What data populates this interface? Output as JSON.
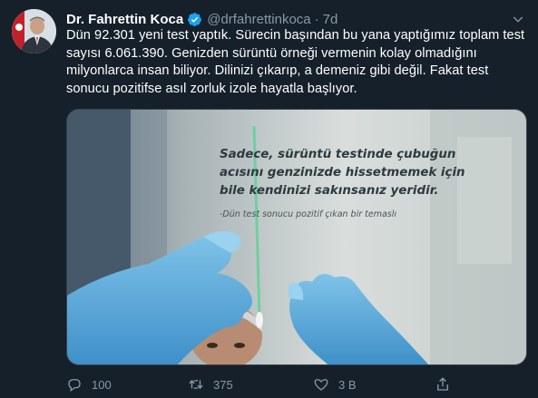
{
  "tweet": {
    "author_name": "Dr. Fahrettin Koca",
    "handle": "@drfahrettinkoca",
    "separator": "·",
    "time": "7d",
    "text": "Dün 92.301 yeni test yaptık. Sürecin başından bu yana yaptığımız toplam test sayısı 6.061.390. Genizden sürüntü örneği vermenin kolay olmadığını milyonlarca insan biliyor. Dilinizi çıkarıp, a demeniz gibi değil. Fakat test sonucu pozitifse asıl zorluk izole hayatla başlıyor."
  },
  "media": {
    "quote": "Sadece, sürüntü testinde çubuğun acısını genzinizde hissetmemek için bile kendinizi sakınsanız yeridir.",
    "attribution": "-Dün test sonucu pozitif çıkan bir temaslı"
  },
  "actions": {
    "reply_count": "100",
    "retweet_count": "375",
    "like_count": "3 B"
  },
  "colors": {
    "background": "#15202b",
    "verified_blue": "#1da1f2",
    "muted_text": "#8899a6"
  },
  "icons": [
    "verified-badge-icon",
    "chevron-down-icon",
    "reply-icon",
    "retweet-icon",
    "like-icon",
    "share-icon"
  ]
}
